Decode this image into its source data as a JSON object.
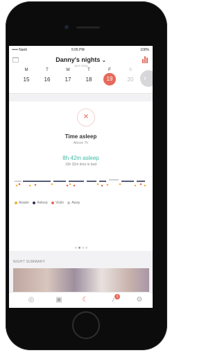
{
  "status_bar": {
    "carrier": "••••• Nanit",
    "time": "5:05 PM",
    "battery": "100%"
  },
  "header": {
    "title": "Danny's nights",
    "date": "JULY 2018"
  },
  "week": [
    {
      "label": "M",
      "num": "15"
    },
    {
      "label": "T",
      "num": "16"
    },
    {
      "label": "W",
      "num": "17"
    },
    {
      "label": "T",
      "num": "18"
    },
    {
      "label": "F",
      "num": "19"
    },
    {
      "label": "S",
      "num": "20"
    }
  ],
  "selected_day": "19",
  "metric": {
    "title": "Time asleep",
    "subtitle": "Above 7h",
    "asleep": "8h 42m asleep",
    "in_bed": "10h 32m time in bed"
  },
  "legend": [
    {
      "label": "Awake",
      "color": "#f0b43c"
    },
    {
      "label": "Asleep",
      "color": "#2c3354"
    },
    {
      "label": "Visits",
      "color": "#e56a5c"
    },
    {
      "label": "Away",
      "color": "#c4c4c8"
    }
  ],
  "night_summary_label": "NIGHT SUMMARY",
  "tabs": [
    {
      "name": "camera-icon"
    },
    {
      "name": "briefcase-icon"
    },
    {
      "name": "moon-icon",
      "active": true
    },
    {
      "name": "notifications-icon",
      "badge": "1"
    },
    {
      "name": "settings-icon"
    }
  ],
  "colors": {
    "accent": "#e56a5c",
    "asleep_text": "#3cb9a4"
  }
}
